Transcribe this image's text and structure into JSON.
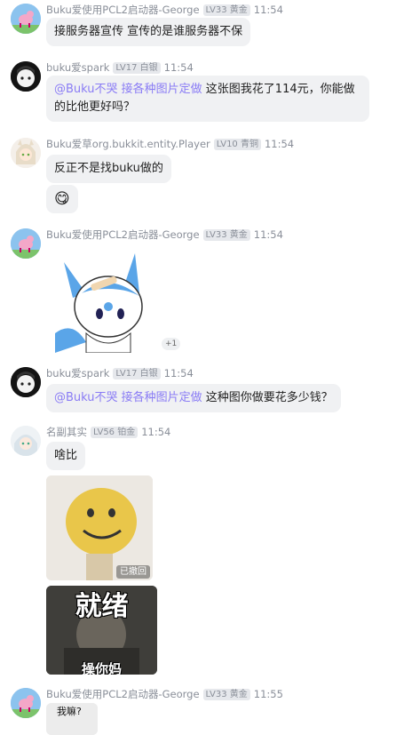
{
  "messages": [
    {
      "sender": "Buku爱使用PCL2启动器-George",
      "level": "LV33 黄金",
      "time": "11:54",
      "text": "接服务器宣传 宣传的是谁服务器不保"
    },
    {
      "sender": "buku爱spark",
      "level": "LV17 白银",
      "time": "11:54",
      "mention": "@Buku不哭 接各种图片定做",
      "text": " 这张图我花了114元，你能做的比他更好吗？"
    },
    {
      "sender": "Buku爱草org.bukkit.entity.Player",
      "level": "LV10 青铜",
      "time": "11:54",
      "text": "反正不是找buku做的",
      "emoji": "😋"
    },
    {
      "sender": "Buku爱使用PCL2启动器-George",
      "level": "LV33 黄金",
      "time": "11:54",
      "badge": "+1"
    },
    {
      "sender": "buku爱spark",
      "level": "LV17 白银",
      "time": "11:54",
      "mention": "@Buku不哭 接各种图片定做",
      "text": " 这种图你做要花多少钱？"
    },
    {
      "sender": "名副其实",
      "level": "LV56 铂金",
      "time": "11:54",
      "text": "啥比",
      "recalled": "已撤回",
      "sticker_top": "就绪",
      "sticker_bottom": "操你妈"
    },
    {
      "sender": "Buku爱使用PCL2启动器-George",
      "level": "LV33 黄金",
      "time": "11:55",
      "caption": "我嘛?"
    }
  ],
  "colors": {
    "mention": "#8a7cf5",
    "bubble": "#f0f1f3",
    "meta": "#8a8f99"
  }
}
